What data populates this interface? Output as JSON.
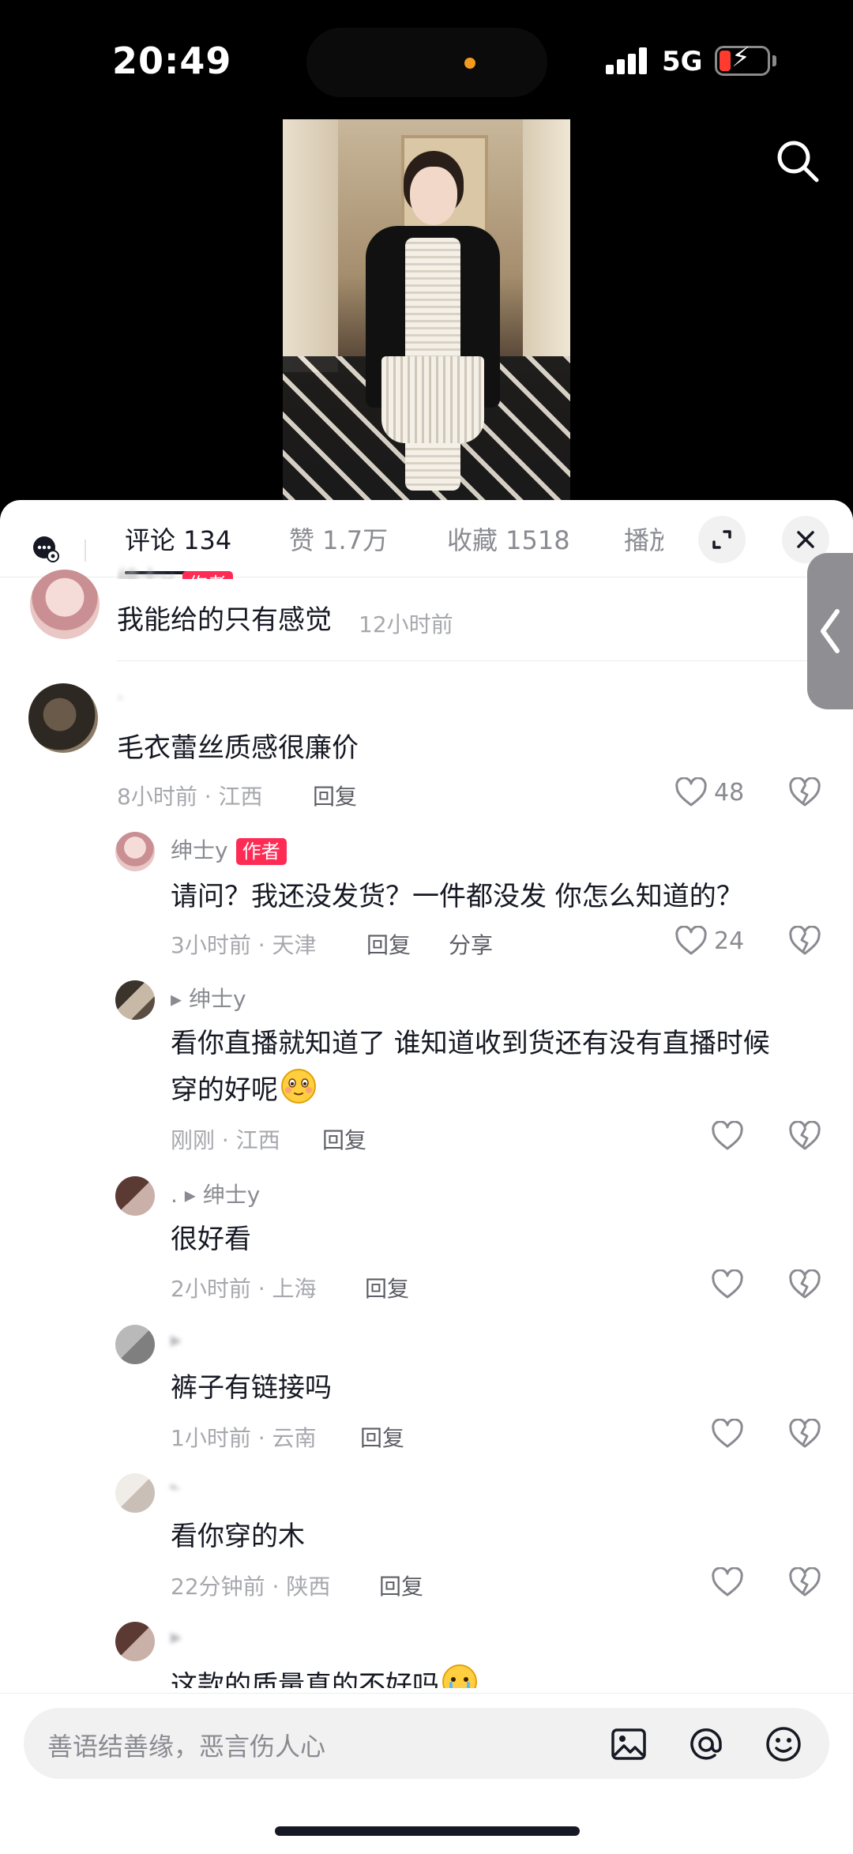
{
  "status_bar": {
    "time": "20:49",
    "network": "5G"
  },
  "video": {
    "search_icon": "search-icon"
  },
  "tabs": [
    {
      "label": "评论 134"
    },
    {
      "label": "赞 1.7万"
    },
    {
      "label": "收藏 1518"
    },
    {
      "label": "播放"
    }
  ],
  "comments": [
    {
      "user": "绅士y",
      "tag": "作者",
      "text": "我能给的只有感觉",
      "time": "12小时前"
    },
    {
      "user": "·",
      "text": "毛衣蕾丝质感很廉价",
      "time": "8小时前 · 江西",
      "reply": "回复",
      "likes": "48"
    },
    {
      "user": "绅士y",
      "tag": "作者",
      "text": "请问？我还没发货？一件都没发 你怎么知道的？",
      "time": "3小时前 · 天津",
      "reply": "回复",
      "share": "分享",
      "likes": "24"
    },
    {
      "user": "▸ 绅士y",
      "text": "看你直播就知道了 谁知道收到货还有没有直播时候",
      "text2": "穿的好呢",
      "time": "刚刚 · 江西",
      "reply": "回复"
    },
    {
      "user": ". ▸ 绅士y",
      "text": "很好看",
      "time": "2小时前 · 上海",
      "reply": "回复"
    },
    {
      "user": "▸",
      "text": "裤子有链接吗",
      "time": "1小时前 · 云南",
      "reply": "回复"
    },
    {
      "user": "▸",
      "text": "看你穿的木",
      "time": "22分钟前 · 陕西",
      "reply": "回复"
    },
    {
      "user": "▸",
      "text": "这款的质量真的不好吗"
    }
  ],
  "input": {
    "placeholder": "善语结善缘，恶言伤人心"
  },
  "colors": {
    "accent": "#fe2c55",
    "text": "#161823",
    "muted": "#8a8b91"
  }
}
